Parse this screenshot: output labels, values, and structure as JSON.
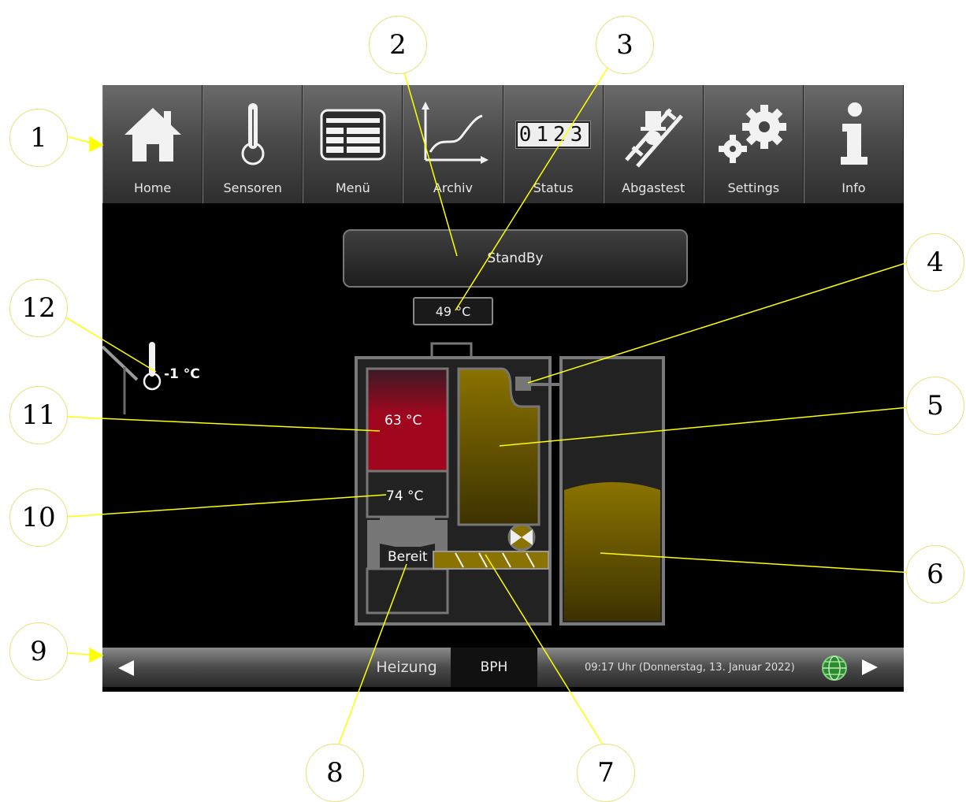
{
  "nav": {
    "items": [
      {
        "label": "Home",
        "icon": "home-icon"
      },
      {
        "label": "Sensoren",
        "icon": "thermometer-icon"
      },
      {
        "label": "Menü",
        "icon": "menu-list-icon"
      },
      {
        "label": "Archiv",
        "icon": "chart-icon"
      },
      {
        "label": "Status",
        "icon": "counter-icon",
        "counter_digits": "0123"
      },
      {
        "label": "Abgastest",
        "icon": "chimney-sweep-icon"
      },
      {
        "label": "Settings",
        "icon": "gears-icon"
      },
      {
        "label": "Info",
        "icon": "info-icon"
      }
    ]
  },
  "status": {
    "mode": "StandBy",
    "temperature": "49 °C"
  },
  "outdoor": {
    "temperature": "-1 °C"
  },
  "boiler": {
    "buffer_temp": "63 °C",
    "combustion_temp": "74 °C",
    "burner_state": "Bereit"
  },
  "bottombar": {
    "tab1": "Heizung",
    "tab2": "BPH",
    "datetime": "09:17 Uhr (Donnerstag, 13. Januar 2022)"
  },
  "callouts": [
    "1",
    "2",
    "3",
    "4",
    "5",
    "6",
    "7",
    "8",
    "9",
    "10",
    "11",
    "12"
  ],
  "colors": {
    "buffer_red": "#a0071e",
    "pellet_gold": "#8a7300",
    "callout_yellow": "#ffff00"
  }
}
